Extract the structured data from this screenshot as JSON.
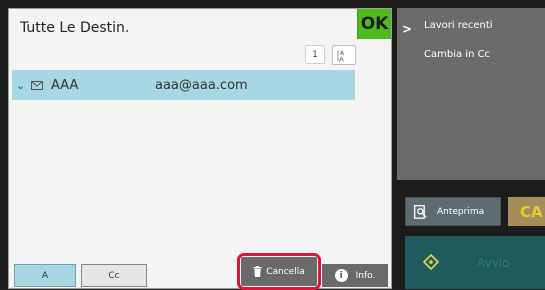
{
  "dialog": {
    "title": "Tutte Le Destin.",
    "ok_label": "OK",
    "page_number": "1",
    "destinations": [
      {
        "name": "AAA",
        "address": "aaa@aaa.com"
      }
    ]
  },
  "bottom_tabs": {
    "a_label": "A",
    "cc_label": "Cc"
  },
  "actions": {
    "cancel_label": "Cancella",
    "info_label": "Info."
  },
  "right_panel": {
    "recent_label": "Lavori recenti",
    "change_cc_label": "Cambia in Cc",
    "preview_label": "Anteprima",
    "ca_label": "CA",
    "start_label": "Avvio"
  },
  "colors": {
    "ok_green": "#4dbb1c",
    "selection_blue": "#a6d7e3",
    "highlight_red": "#d8173d",
    "ca_gold": "#e7cc2f",
    "start_teal": "#1f5b5c"
  },
  "icons": [
    "chevron-down-icon",
    "envelope-icon",
    "sort-az-icon",
    "trash-icon",
    "info-icon",
    "chevron-right-icon",
    "preview-icon",
    "start-icon"
  ]
}
